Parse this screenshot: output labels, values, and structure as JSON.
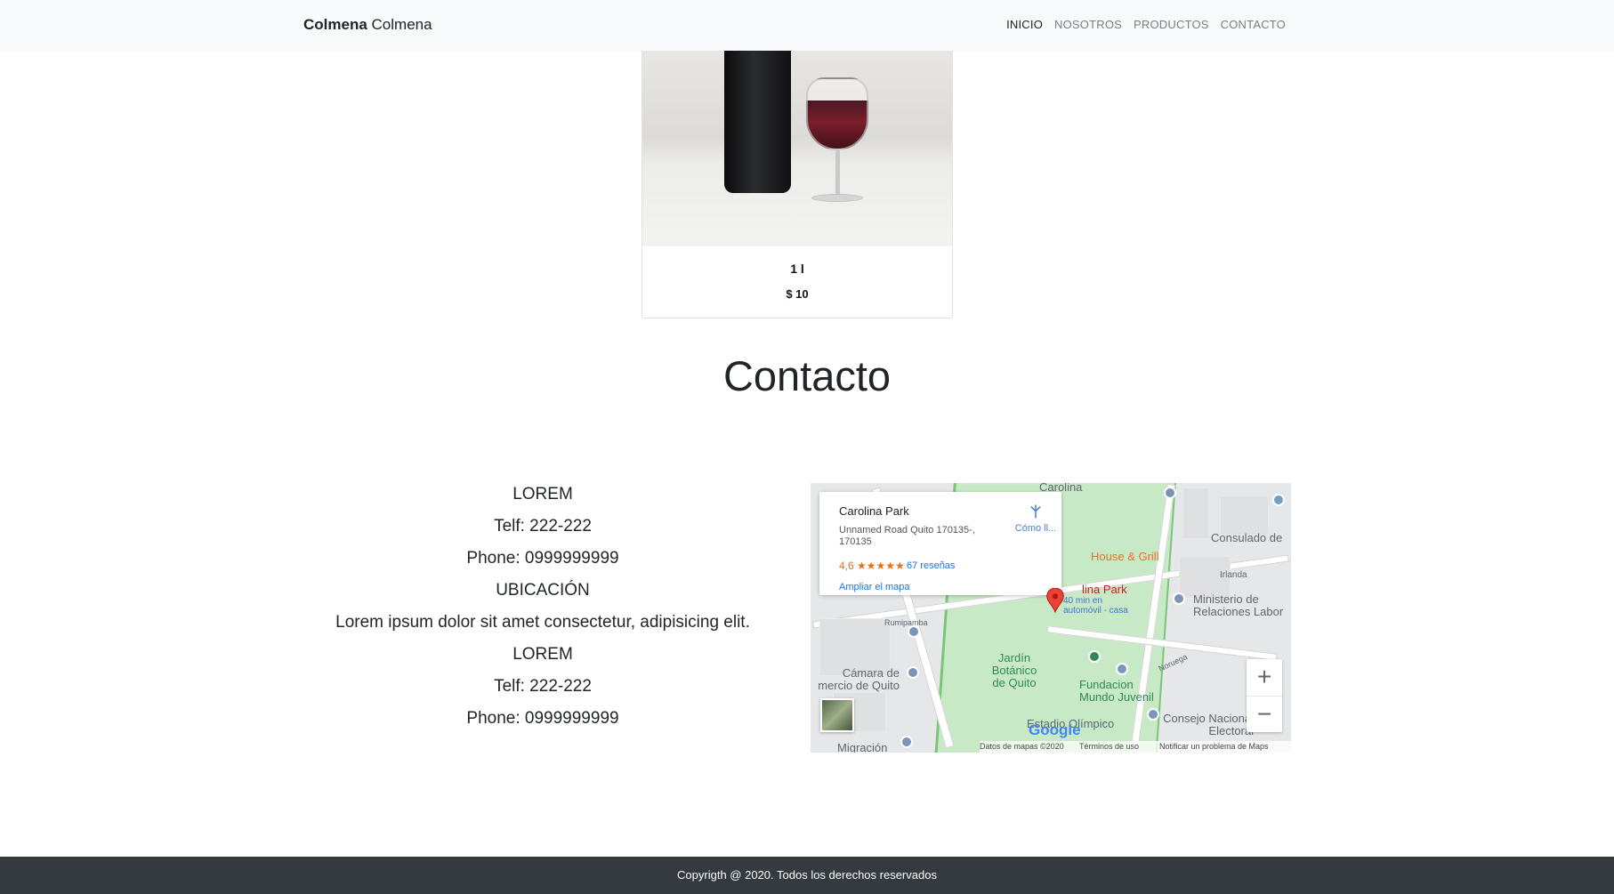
{
  "navbar": {
    "brand_bold": "Colmena",
    "brand_text": "Colmena",
    "links": [
      "INICIO",
      "NOSOTROS",
      "PRODUCTOS",
      "CONTACTO"
    ]
  },
  "product": {
    "size": "1 l",
    "price": "$ 10"
  },
  "contact": {
    "title": "Contacto",
    "lines": [
      "LOREM",
      "Telf: 222-222",
      "Phone: 0999999999",
      "UBICACIÓN",
      "Lorem ipsum dolor sit amet consectetur, adipisicing elit.",
      "LOREM",
      "Telf: 222-222",
      "Phone: 0999999999"
    ]
  },
  "map": {
    "place": "Carolina Park",
    "address": "Unnamed Road Quito 170135-, 170135",
    "rating": "4,6 ★★★★★",
    "reviews": "67 reseñas",
    "expand_link": "Ampliar el mapa",
    "directions": "Cómo ll...",
    "labels": {
      "carolina_top": "Carolina",
      "consulado": "Consulado de",
      "house_grill": "House & Grill",
      "irlanda": "Irlanda",
      "carolina_park": "lina Park",
      "travel_time": "40 min en automóvil - casa",
      "ministerio": "Ministerio de Relaciones Labor",
      "rumipamba": "Rumipamba",
      "jardin": "Jardín Botánico de Quito",
      "fundacion": "Fundacion Mundo Juvenil",
      "camara": "Cámara de mercio de Quito",
      "consejo": "Consejo Nacional Electoral",
      "migracion": "Migración",
      "estadio": "Estadio Olímpico",
      "noruega": "Noruega"
    },
    "zoom_in": "+",
    "zoom_out": "−",
    "google": "Google",
    "footer": {
      "data": "Datos de mapas ©2020",
      "terms": "Términos de uso",
      "report": "Notificar un problema de Maps"
    }
  },
  "footer": {
    "copyright": "Copyrigth @ 2020. Todos los derechos reservados"
  }
}
